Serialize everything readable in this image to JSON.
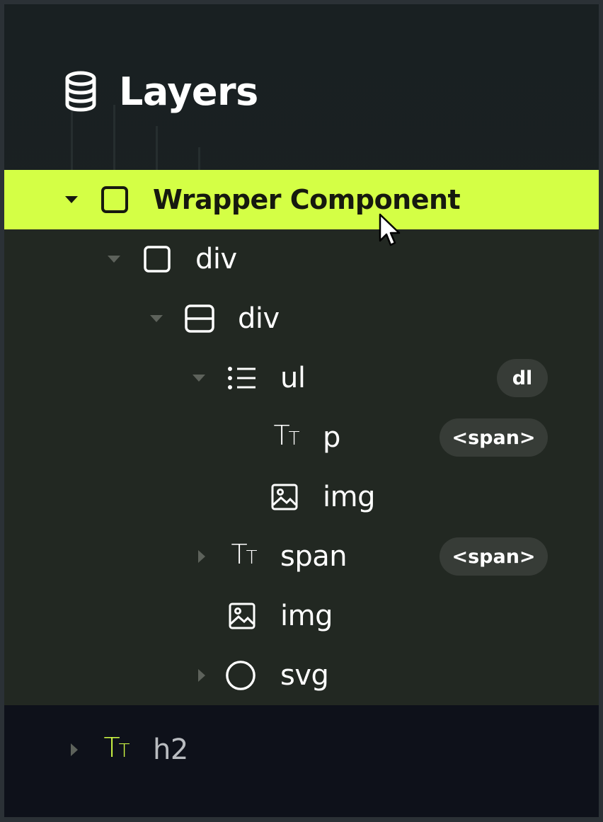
{
  "header": {
    "title": "Layers",
    "icon": "database-icon"
  },
  "colors": {
    "accent": "#d4ff45",
    "panel_bg": "#192022",
    "tree_bg": "#222822",
    "footer_bg": "#0e111a",
    "badge_bg": "#373c37"
  },
  "tree": {
    "root": {
      "label": "Wrapper Component",
      "icon": "square-icon",
      "expanded": true,
      "selected": true
    },
    "div1": {
      "label": "div",
      "icon": "square-icon",
      "expanded": true
    },
    "div2": {
      "label": "div",
      "icon": "split-rows-icon",
      "expanded": true
    },
    "ul": {
      "label": "ul",
      "icon": "list-icon",
      "expanded": true,
      "badge": "dl"
    },
    "p": {
      "label": "p",
      "icon": "text-icon",
      "badge": "<span>"
    },
    "img1": {
      "label": "img",
      "icon": "image-icon"
    },
    "span": {
      "label": "span",
      "icon": "text-icon",
      "expanded": false,
      "badge": "<span>"
    },
    "img2": {
      "label": "img",
      "icon": "image-icon"
    },
    "svg": {
      "label": "svg",
      "icon": "circle-icon",
      "expanded": false
    }
  },
  "footer": {
    "h2": {
      "label": "h2",
      "icon": "text-icon",
      "expanded": false
    }
  }
}
